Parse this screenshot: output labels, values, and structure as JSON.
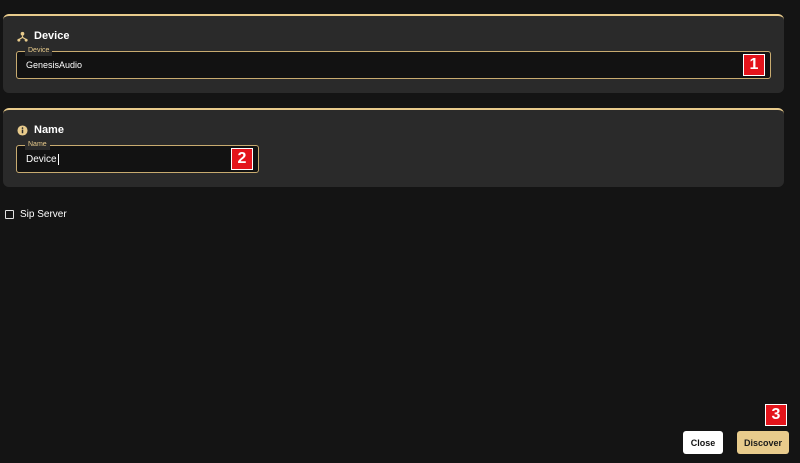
{
  "device_section": {
    "title": "Device",
    "icon": "device-hub-icon",
    "field_label": "Device",
    "field_value": "GenesisAudio",
    "badge": "1"
  },
  "name_section": {
    "title": "Name",
    "icon": "info-icon",
    "field_label": "Name",
    "field_value": "Device",
    "badge": "2"
  },
  "sip_server": {
    "label": "Sip Server",
    "checked": false
  },
  "actions": {
    "close_label": "Close",
    "discover_label": "Discover",
    "discover_badge": "3"
  },
  "colors": {
    "accent": "#e8cb8c",
    "background": "#141414",
    "card": "#2a2a2a",
    "badge": "#e4141b"
  }
}
